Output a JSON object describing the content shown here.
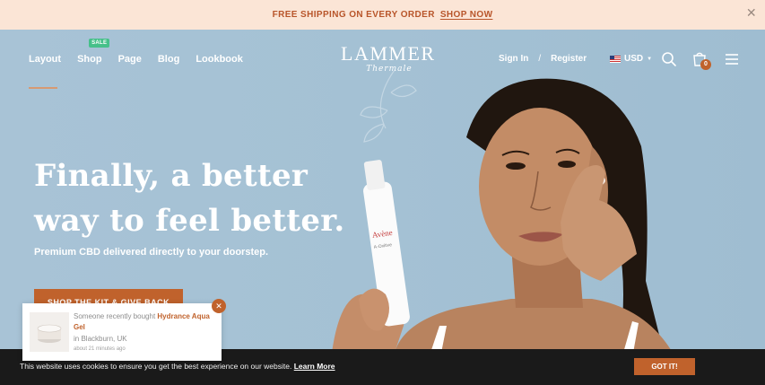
{
  "announcement": {
    "text": "FREE SHIPPING ON EVERY ORDER",
    "link": "SHOP NOW",
    "close_icon": "close-icon"
  },
  "header": {
    "nav": [
      {
        "label": "Layout"
      },
      {
        "label": "Shop",
        "badge": "SALE"
      },
      {
        "label": "Page"
      },
      {
        "label": "Blog"
      },
      {
        "label": "Lookbook"
      }
    ],
    "logo": {
      "main": "LAMMER",
      "sub": "Thermale"
    },
    "sign_in": "Sign In",
    "separator": "/",
    "register": "Register",
    "currency": "USD",
    "icons": [
      "search-icon",
      "cart-icon",
      "menu-icon"
    ],
    "cart_count": "0"
  },
  "hero": {
    "headline_line1": "Finally, a better",
    "headline_line2": "way to feel better.",
    "subline": "Premium CBD delivered directly to your doorstep.",
    "cta": "SHOP THE KIT & GIVE BACK",
    "product_label": "Avène",
    "product_label2": "A-Oxitive"
  },
  "popup": {
    "prefix": "Someone recently bought",
    "product": "Hydrance Aqua Gel",
    "location": "in Blackburn, UK",
    "time": "about 21 minutes ago"
  },
  "cookie": {
    "message": "This website uses cookies to ensure you get the best experience on our website.",
    "learn_more": "Learn More",
    "accept": "GOT IT!"
  },
  "colors": {
    "accent": "#c0622c",
    "hero_bg": "#a6c2d5",
    "announcement_bg": "#fbe5d6",
    "sale_badge": "#46c08a"
  }
}
